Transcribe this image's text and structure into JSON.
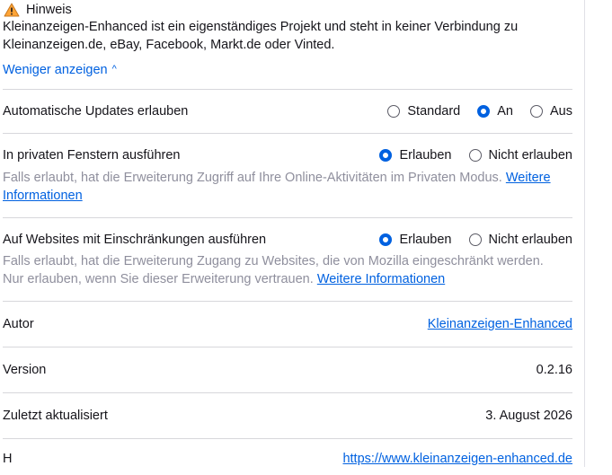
{
  "notice": {
    "title": "Hinweis",
    "text_line1": "Kleinanzeigen-Enhanced ist ein eigenständiges Projekt und steht in keiner Verbindung zu",
    "text_line2": "Kleinanzeigen.de, eBay, Facebook, Markt.de oder Vinted.",
    "show_less": "Weniger anzeigen",
    "icon": "warning-icon",
    "icon_color": "#ffa436"
  },
  "updates": {
    "label": "Automatische Updates erlauben",
    "options": [
      "Standard",
      "An",
      "Aus"
    ],
    "selected": "An"
  },
  "private": {
    "label": "In privaten Fenstern ausführen",
    "options": [
      "Erlauben",
      "Nicht erlauben"
    ],
    "selected": "Erlauben",
    "desc": "Falls erlaubt, hat die Erweiterung Zugriff auf Ihre Online-Aktivitäten im Privaten Modus.",
    "link_part1": "Weitere",
    "link_part2": "Informationen"
  },
  "restricted": {
    "label": "Auf Websites mit Einschränkungen ausführen",
    "options": [
      "Erlauben",
      "Nicht erlauben"
    ],
    "selected": "Erlauben",
    "desc_line1": "Falls erlaubt, hat die Erweiterung Zugang zu Websites, die von Mozilla eingeschränkt werden.",
    "desc_line2": "Nur erlauben, wenn Sie dieser Erweiterung vertrauen.",
    "link": "Weitere Informationen"
  },
  "author": {
    "label": "Autor",
    "value": "Kleinanzeigen-Enhanced"
  },
  "version": {
    "label": "Version",
    "value": "0.2.16"
  },
  "updated": {
    "label": "Zuletzt aktualisiert",
    "value": "3. August 2026"
  },
  "homepage": {
    "label": "H",
    "value": "https://www.kleinanzeigen-enhanced.de"
  },
  "colors": {
    "accent": "#0061e0",
    "muted": "#8f8f9d",
    "divider": "#d7d7db"
  }
}
